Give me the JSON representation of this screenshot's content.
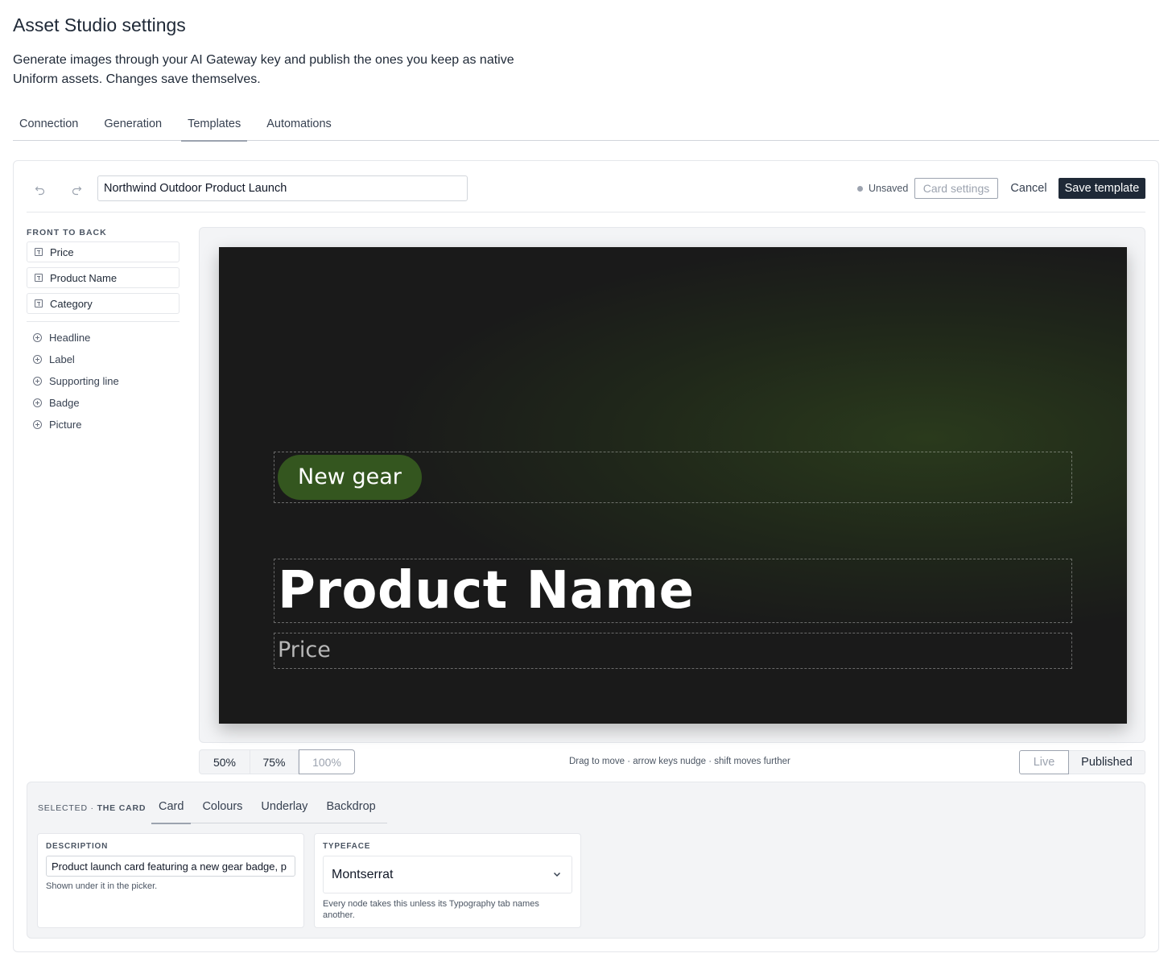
{
  "page": {
    "title": "Asset Studio settings",
    "description": "Generate images through your AI Gateway key and publish the ones you keep as native Uniform assets. Changes save themselves."
  },
  "tabs": [
    {
      "label": "Connection",
      "active": false
    },
    {
      "label": "Generation",
      "active": false
    },
    {
      "label": "Templates",
      "active": true
    },
    {
      "label": "Automations",
      "active": false
    }
  ],
  "toolbar": {
    "template_name": "Northwind Outdoor Product Launch",
    "status": "Unsaved",
    "card_settings_label": "Card settings",
    "cancel_label": "Cancel",
    "save_label": "Save template"
  },
  "layers": {
    "heading": "FRONT TO BACK",
    "items": [
      {
        "label": "Price",
        "icon": "text-icon"
      },
      {
        "label": "Product Name",
        "icon": "text-icon"
      },
      {
        "label": "Category",
        "icon": "text-icon"
      }
    ],
    "add_items": [
      {
        "label": "Headline",
        "icon": "plus-circle-icon"
      },
      {
        "label": "Label",
        "icon": "plus-circle-icon"
      },
      {
        "label": "Supporting line",
        "icon": "plus-circle-icon"
      },
      {
        "label": "Badge",
        "icon": "plus-circle-icon"
      },
      {
        "label": "Picture",
        "icon": "plus-circle-icon"
      }
    ]
  },
  "card": {
    "badge_text": "New gear",
    "name_text": "Product Name",
    "price_text": "Price",
    "colors": {
      "background": "#1a1a1a",
      "glow": "#2a3a1c",
      "badge": "#34561f",
      "name": "#ffffff",
      "price": "#b8b8b8"
    }
  },
  "zoom": {
    "options": [
      "50%",
      "75%",
      "100%"
    ],
    "selected": "100%"
  },
  "hint": "Drag to move · arrow keys nudge · shift moves further",
  "view": {
    "live_label": "Live",
    "published_label": "Published",
    "selected": "Live"
  },
  "inspector": {
    "selected_prefix": "SELECTED · ",
    "selected_name": "THE CARD",
    "tabs": [
      {
        "label": "Card",
        "active": true
      },
      {
        "label": "Colours",
        "active": false
      },
      {
        "label": "Underlay",
        "active": false
      },
      {
        "label": "Backdrop",
        "active": false
      }
    ],
    "description": {
      "label": "DESCRIPTION",
      "value": "Product launch card featuring a new gear badge, p",
      "help": "Shown under it in the picker."
    },
    "typeface": {
      "label": "TYPEFACE",
      "value": "Montserrat",
      "help": "Every node takes this unless its Typography tab names another."
    }
  },
  "colors": {
    "accent_dark": "#1f2937",
    "border": "#e5e7eb",
    "panel_bg": "#f3f4f6"
  }
}
